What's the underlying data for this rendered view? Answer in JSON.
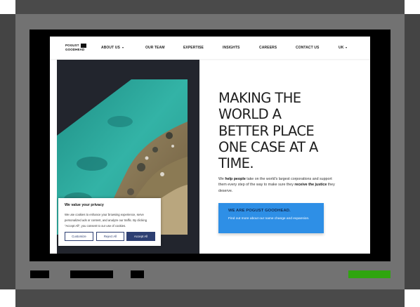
{
  "site": {
    "logo_text_line1": "POGUST",
    "logo_text_line2": "GOODHEAD"
  },
  "nav": {
    "items": [
      {
        "label": "ABOUT US",
        "dropdown": true
      },
      {
        "label": "OUR TEAM",
        "dropdown": false
      },
      {
        "label": "EXPERTISE",
        "dropdown": false
      },
      {
        "label": "INSIGHTS",
        "dropdown": false
      },
      {
        "label": "CAREERS",
        "dropdown": false
      },
      {
        "label": "CONTACT US",
        "dropdown": false
      },
      {
        "label": "UK",
        "dropdown": true
      }
    ]
  },
  "hero": {
    "headline_lines": [
      "MAKING THE",
      "WORLD A",
      "BETTER PLACE",
      "ONE CASE AT A",
      "TIME."
    ],
    "intro": {
      "p1": "We ",
      "b1": "help people",
      "p2": " take on the world's largest corporations and support them every step of the way to make sure they ",
      "b2": "receive the justice",
      "p3": " they deserve."
    },
    "image_alt_icon": "aerial-coastline-image"
  },
  "cta": {
    "title": "WE ARE POGUST GOODHEAD.",
    "text": "Find out more about our name change and expansion."
  },
  "cookie_banner": {
    "title": "We value your privacy",
    "text": "We use cookies to enhance your browsing experience, serve personalized ads or content, and analyze our traffic. By clicking \"Accept All\", you consent to our use of cookies.",
    "buttons": {
      "customize": "Customize",
      "reject": "Reject All",
      "accept": "Accept All"
    }
  },
  "colors": {
    "cta_background": "#2e8fe6",
    "cta_title": "#0f2c55",
    "dark_panel": "#22252d",
    "cookie_primary": "#2d3f72",
    "taskbar_green": "#2fa50f"
  }
}
